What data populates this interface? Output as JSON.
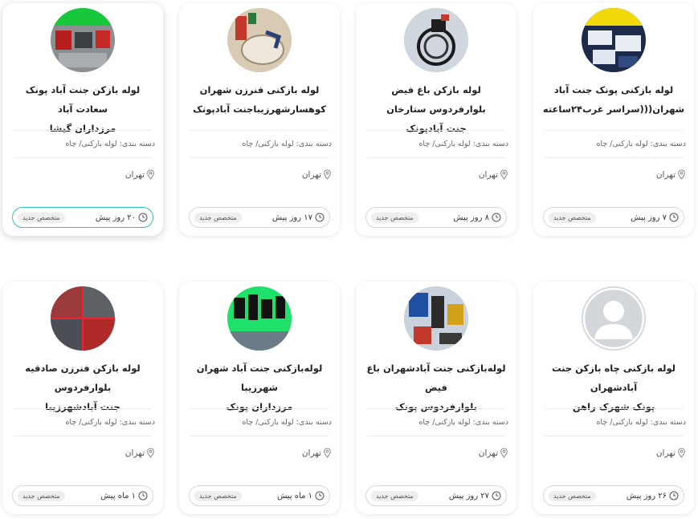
{
  "cards": [
    {
      "title_line1": "لوله بازکنی پونک جنت آباد",
      "title_line2": "شهران(((سراسر غرب۲۴ساعته",
      "category": "دسته بندی: لوله بازکنی/ چاه",
      "city": "تهران",
      "time": "۷ روز پیش",
      "badge": "متخصص جدید",
      "avatar_icon": "photo-thumbnail-icon"
    },
    {
      "title_line1": "لوله بازکن باغ فیض بلوارفردوس ستارخان",
      "title_line2": "جنت آبادپونک",
      "category": "دسته بندی: لوله بازکنی/ چاه",
      "city": "تهران",
      "time": "۸ روز پیش",
      "badge": "متخصص جدید",
      "avatar_icon": "photo-thumbnail-icon"
    },
    {
      "title_line1": "لوله بازکنی فنرزن شهران",
      "title_line2": "کوهسارشهرزیباجنت آبادپونک",
      "category": "دسته بندی: لوله بازکنی/ چاه",
      "city": "تهران",
      "time": "۱۷ روز پیش",
      "badge": "متخصص جدید",
      "avatar_icon": "photo-thumbnail-icon"
    },
    {
      "title_line1": "لوله بازکن جنت آباد پونک سعادت آباد",
      "title_line2": "مرزداران گیشا",
      "category": "دسته بندی: لوله بازکنی/ چاه",
      "city": "تهران",
      "time": "۲۰ روز پیش",
      "badge": "متخصص جدید",
      "avatar_icon": "photo-thumbnail-icon"
    },
    {
      "title_line1": "لوله بازکنی چاه بازکن جنت آبادشهران",
      "title_line2": "پونک شهرک راهن",
      "category": "دسته بندی: لوله بازکنی/ چاه",
      "city": "تهران",
      "time": "۲۶ روز پیش",
      "badge": "متخصص جدید",
      "avatar_icon": "default-user-icon"
    },
    {
      "title_line1": "لوله‌بازکنی جنت آبادشهران باغ فیض",
      "title_line2": "بلوارفردوس پونک",
      "category": "دسته بندی: لوله بازکنی/ چاه",
      "city": "تهران",
      "time": "۲۷ روز پیش",
      "badge": "متخصص جدید",
      "avatar_icon": "photo-thumbnail-icon"
    },
    {
      "title_line1": "لوله‌بازکنی جنت آباد شهران شهرزیبا",
      "title_line2": "مرزداران پونک",
      "category": "دسته بندی: لوله بازکنی/ چاه",
      "city": "تهران",
      "time": "۱ ماه پیش",
      "badge": "متخصص جدید",
      "avatar_icon": "photo-thumbnail-icon"
    },
    {
      "title_line1": "لوله بازکن فنرزن صادقیه بلوارفردوس",
      "title_line2": "جنت آبادشهرزیبا",
      "category": "دسته بندی: لوله بازکنی/ چاه",
      "city": "تهران",
      "time": "۱ ماه پیش",
      "badge": "متخصص جدید",
      "avatar_icon": "photo-thumbnail-icon"
    }
  ],
  "colors": {
    "active_border": "#2ec4b6",
    "badge_bg": "#eeeeee",
    "card_bg": "#ffffff"
  }
}
